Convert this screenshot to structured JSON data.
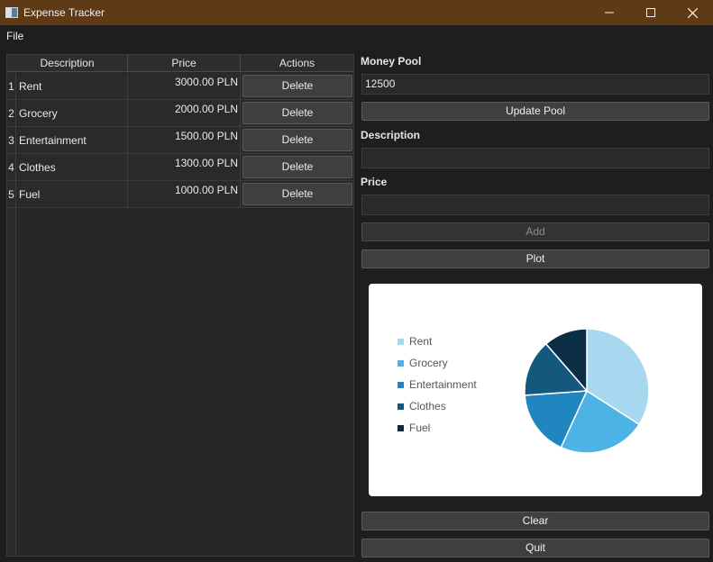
{
  "window": {
    "title": "Expense Tracker"
  },
  "menu": {
    "file_label": "File"
  },
  "table": {
    "headers": {
      "description": "Description",
      "price": "Price",
      "actions": "Actions"
    },
    "rows": [
      {
        "index": "1",
        "description": "Rent",
        "price": "3000.00 PLN",
        "action": "Delete"
      },
      {
        "index": "2",
        "description": "Grocery",
        "price": "2000.00 PLN",
        "action": "Delete"
      },
      {
        "index": "3",
        "description": "Entertainment",
        "price": "1500.00 PLN",
        "action": "Delete"
      },
      {
        "index": "4",
        "description": "Clothes",
        "price": "1300.00 PLN",
        "action": "Delete"
      },
      {
        "index": "5",
        "description": "Fuel",
        "price": "1000.00 PLN",
        "action": "Delete"
      }
    ]
  },
  "form": {
    "money_pool_label": "Money Pool",
    "money_pool_value": "12500",
    "update_pool_label": "Update Pool",
    "description_label": "Description",
    "description_value": "",
    "price_label": "Price",
    "price_value": "",
    "add_label": "Add",
    "plot_label": "Plot",
    "clear_label": "Clear",
    "quit_label": "Quit"
  },
  "chart_data": {
    "type": "pie",
    "categories": [
      "Rent",
      "Grocery",
      "Entertainment",
      "Clothes",
      "Fuel"
    ],
    "values": [
      3000,
      2000,
      1500,
      1300,
      1000
    ],
    "colors": [
      "#a8d8f0",
      "#4db3e6",
      "#1f86bf",
      "#14597d",
      "#0b2e46"
    ],
    "legend_position": "left"
  }
}
